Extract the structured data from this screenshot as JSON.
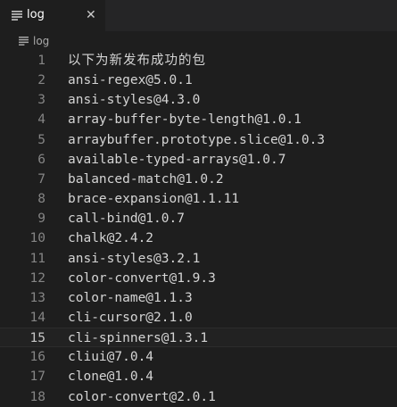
{
  "tab": {
    "label": "log",
    "icon": "lines-icon",
    "close": "✕"
  },
  "breadcrumb": {
    "label": "log",
    "icon": "lines-icon"
  },
  "editor": {
    "current_line": 15,
    "lines": [
      {
        "num": "1",
        "text": "以下为新发布成功的包"
      },
      {
        "num": "2",
        "text": "ansi-regex@5.0.1"
      },
      {
        "num": "3",
        "text": "ansi-styles@4.3.0"
      },
      {
        "num": "4",
        "text": "array-buffer-byte-length@1.0.1"
      },
      {
        "num": "5",
        "text": "arraybuffer.prototype.slice@1.0.3"
      },
      {
        "num": "6",
        "text": "available-typed-arrays@1.0.7"
      },
      {
        "num": "7",
        "text": "balanced-match@1.0.2"
      },
      {
        "num": "8",
        "text": "brace-expansion@1.1.11"
      },
      {
        "num": "9",
        "text": "call-bind@1.0.7"
      },
      {
        "num": "10",
        "text": "chalk@2.4.2"
      },
      {
        "num": "11",
        "text": "ansi-styles@3.2.1"
      },
      {
        "num": "12",
        "text": "color-convert@1.9.3"
      },
      {
        "num": "13",
        "text": "color-name@1.1.3"
      },
      {
        "num": "14",
        "text": "cli-cursor@2.1.0"
      },
      {
        "num": "15",
        "text": "cli-spinners@1.3.1"
      },
      {
        "num": "16",
        "text": "cliui@7.0.4"
      },
      {
        "num": "17",
        "text": "clone@1.0.4"
      },
      {
        "num": "18",
        "text": "color-convert@2.0.1"
      }
    ]
  }
}
